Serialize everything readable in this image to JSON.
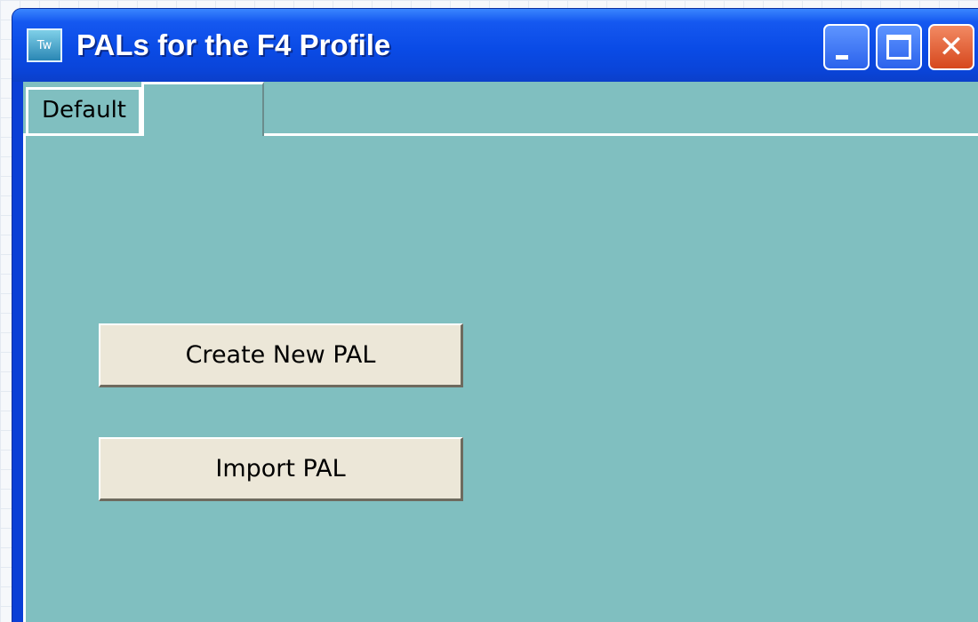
{
  "window": {
    "title": "PALs for the F4 Profile",
    "icon": {
      "name": "app-icon",
      "label": "Tw"
    }
  },
  "titlebar_buttons": [
    {
      "name": "minimize-icon"
    },
    {
      "name": "maximize-icon"
    },
    {
      "name": "close-icon",
      "glyph": "✕"
    }
  ],
  "tabs": [
    {
      "label": "Default"
    },
    {
      "label": ""
    }
  ],
  "buttons": {
    "create_new": "Create New PAL",
    "import": "Import PAL"
  },
  "colors": {
    "titlebar": "#0a4be6",
    "client_background": "#80bfc0",
    "button_face": "#ece7d8",
    "close_button": "#d6471d"
  }
}
